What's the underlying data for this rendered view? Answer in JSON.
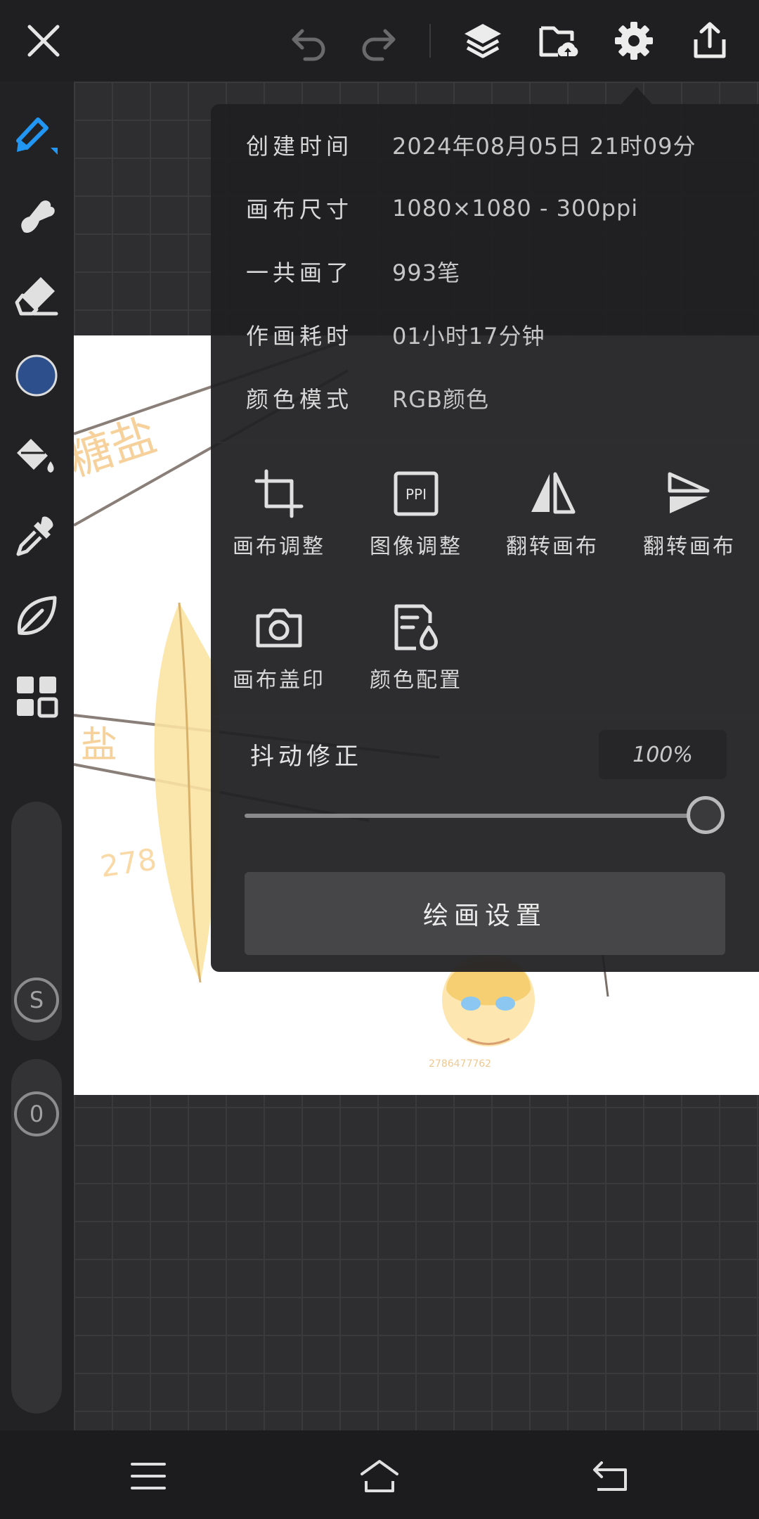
{
  "info": [
    {
      "label": "创建时间",
      "value": "2024年08月05日 21时09分"
    },
    {
      "label": "画布尺寸",
      "value": "1080×1080 - 300ppi"
    },
    {
      "label": "一共画了",
      "value": "993笔"
    },
    {
      "label": "作画耗时",
      "value": "01小时17分钟"
    },
    {
      "label": "颜色模式",
      "value": "RGB颜色"
    }
  ],
  "actions": [
    {
      "label": "画布调整",
      "icon": "crop-icon"
    },
    {
      "label": "图像调整",
      "icon": "ppi-icon",
      "glyph": "PPI"
    },
    {
      "label": "翻转画布",
      "icon": "flip-horizontal-icon"
    },
    {
      "label": "翻转画布",
      "icon": "flip-vertical-icon"
    },
    {
      "label": "画布盖印",
      "icon": "camera-icon"
    },
    {
      "label": "颜色配置",
      "icon": "color-profile-icon"
    }
  ],
  "stabilizer": {
    "label": "抖动修正",
    "value_text": "100%",
    "value": 1.0
  },
  "paint_settings_label": "绘画设置",
  "sidebar": {
    "color": "#2d4f8c",
    "s_label": "S",
    "zero_label": "0"
  },
  "colors": {
    "accent": "#1e88e5",
    "panel": "#202022",
    "current_color": "#2d4f8c"
  }
}
